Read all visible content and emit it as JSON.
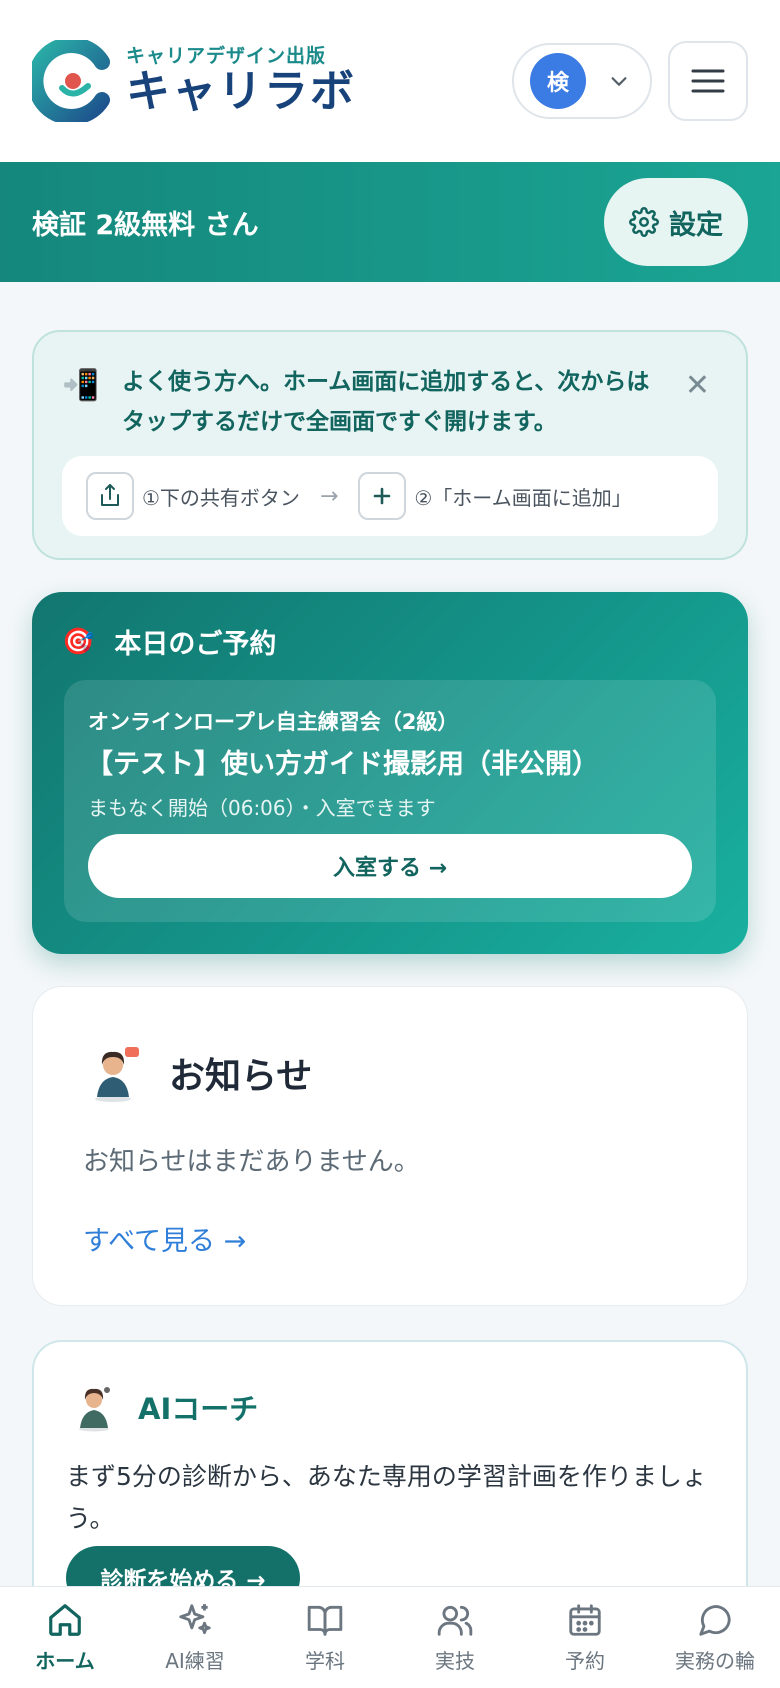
{
  "header": {
    "logo_sub": "キャリアデザイン出版",
    "logo_main": "キャリラボ",
    "avatar_initial": "検",
    "menu_icon": "hamburger-icon"
  },
  "greeting": {
    "name": "検証 2級無料 さん",
    "settings_label": "設定"
  },
  "pwa_banner": {
    "icon": "📲",
    "message": "よく使う方へ。ホーム画面に追加すると、次からはタップするだけで全画面ですぐ開けます。",
    "step1": "①下の共有ボタン",
    "arrow": "→",
    "step2": "②「ホーム画面に追加」"
  },
  "reservation": {
    "icon": "🎯",
    "title": "本日のご予約",
    "category": "オンラインロープレ自主練習会（2級）",
    "name": "【テスト】使い方ガイド撮影用（非公開）",
    "status": "まもなく開始（06:06）・入室できます",
    "enter_button": "入室する →"
  },
  "news": {
    "title": "お知らせ",
    "empty_text": "お知らせはまだありません。",
    "see_all": "すべて見る →"
  },
  "ai_coach": {
    "title": "AIコーチ",
    "description": "まず5分の診断から、あなた専用の学習計画を作りましょう。",
    "button": "診断を始める →"
  },
  "bottom_nav": {
    "items": [
      {
        "label": "ホーム",
        "icon": "home-icon",
        "active": true
      },
      {
        "label": "AI練習",
        "icon": "sparkle-icon",
        "active": false
      },
      {
        "label": "学科",
        "icon": "book-icon",
        "active": false
      },
      {
        "label": "実技",
        "icon": "users-icon",
        "active": false
      },
      {
        "label": "予約",
        "icon": "calendar-icon",
        "active": false
      },
      {
        "label": "実務の輪",
        "icon": "chat-icon",
        "active": false
      }
    ]
  },
  "colors": {
    "brand_teal": "#13716a",
    "brand_navy": "#17427a",
    "avatar_blue": "#3b7be4",
    "link_blue": "#2f7ed8"
  }
}
